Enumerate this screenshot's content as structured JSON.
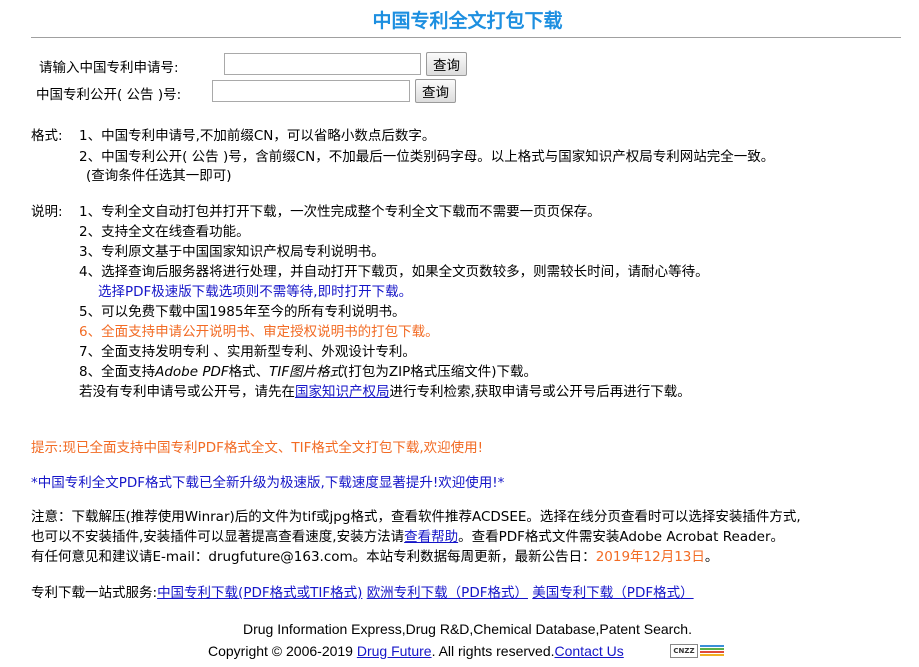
{
  "page_title": "中国专利全文打包下载",
  "search": {
    "app_label": "请输入中国专利申请号:",
    "pub_label": "中国专利公开( 公告 )号:",
    "app_value": "",
    "pub_value": "",
    "app_button": "查询",
    "pub_button": "查询"
  },
  "format": {
    "label": "格式:",
    "line1": "1、中国专利申请号,不加前缀CN，可以省略小数点后数字。",
    "line2": "2、中国专利公开( 公告 )号，含前缀CN，不加最后一位类别码字母。以上格式与国家知识产权局专利网站完全一致。",
    "line3": "(查询条件任选其一即可)"
  },
  "notes": {
    "label": "说明:",
    "line1": "1、专利全文自动打包并打开下载，一次性完成整个专利全文下载而不需要一页页保存。",
    "line2": "2、支持全文在线查看功能。",
    "line3": "3、专利原文基于中国国家知识产权局专利说明书。",
    "line4": "4、选择查询后服务器将进行处理，并自动打开下载页，如果全文页数较多，则需较长时间，请耐心等待。",
    "line4b": "选择PDF极速版下载选项则不需等待,即时打开下载。",
    "line5": "5、可以免费下载中国1985年至今的所有专利说明书。",
    "line6": "6、全面支持申请公开说明书、审定授权说明书的打包下载。",
    "line7": "7、全面支持发明专利 、实用新型专利、外观设计专利。",
    "line8_a": "8、全面支持",
    "line8_pdf": "Adobe PDF",
    "line8_b": "格式、",
    "line8_tif": "TIF图片格式",
    "line8_c": "(打包为ZIP格式压缩文件)下载。",
    "line9_a": "若没有专利申请号或公开号，请先在",
    "line9_link": "国家知识产权局",
    "line9_b": "进行专利检索,获取申请号或公开号后再进行下载。"
  },
  "tip": "提示:现已全面支持中国专利PDF格式全文、TIF格式全文打包下载,欢迎使用!",
  "announce": "*中国专利全文PDF格式下载已全新升级为极速版,下载速度显著提升!欢迎使用!*",
  "notice": {
    "line1": "注意：下载解压(推荐使用Winrar)后的文件为tif或jpg格式，查看软件推荐ACDSEE。选择在线分页查看时可以选择安装插件方式,",
    "line2_a": "也可以不安装插件,安装插件可以显著提高查看速度,安装方法请",
    "line2_link": "查看帮助",
    "line2_b": "。查看PDF格式文件需安装Adobe Acrobat Reader。",
    "line3_a": "有任何意见和建议请E-mail：drugfuture@163.com。本站专利数据每周更新，最新公告日：",
    "line3_date": "2019年12月13日",
    "line3_b": "。"
  },
  "services": {
    "label": "专利下载一站式服务:",
    "link1": "中国专利下载(PDF格式或TIF格式)",
    "link2": "欧洲专利下载（PDF格式）",
    "link3": "美国专利下载（PDF格式）"
  },
  "footer": {
    "line1": "Drug Information Express,Drug R&D,Chemical Database,Patent Search.",
    "copy_a": "Copyright © 2006-2019 ",
    "copy_link": "Drug Future",
    "copy_b": ". All rights reserved.",
    "contact": "Contact Us",
    "badge_text": "CNZZ"
  },
  "colors": {
    "title": "#1d8fe0",
    "link": "#1515c8",
    "orange": "#f26b24"
  }
}
